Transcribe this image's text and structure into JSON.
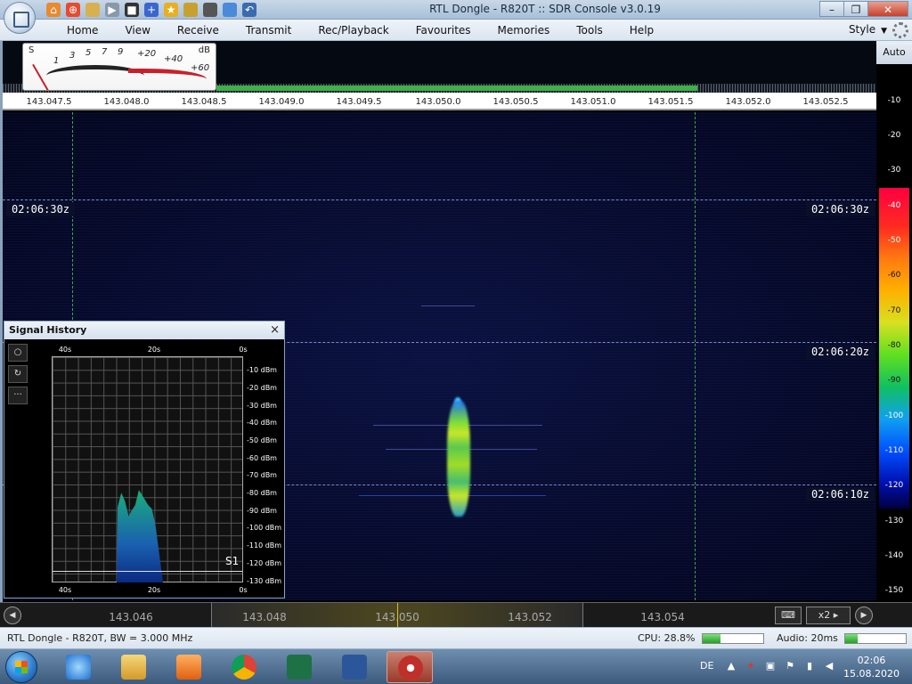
{
  "window": {
    "title": "RTL Dongle - R820T :: SDR Console v3.0.19"
  },
  "menu": [
    "Home",
    "View",
    "Receive",
    "Transmit",
    "Rec/Playback",
    "Favourites",
    "Memories",
    "Tools",
    "Help"
  ],
  "style_label": "Style",
  "smeter": {
    "s_label": "S",
    "db_label": "dB",
    "ticks": [
      "1",
      "3",
      "5",
      "7",
      "9",
      "+20",
      "+40",
      "+60"
    ]
  },
  "freq_scale": [
    "143.047.5",
    "143.048.0",
    "143.048.5",
    "143.049.0",
    "143.049.5",
    "143.050.0",
    "143.050.5",
    "143.051.0",
    "143.051.5",
    "143.052.0",
    "143.052.5"
  ],
  "waterfall": {
    "times": [
      "02:06:30z",
      "02:06:20z",
      "02:06:10z"
    ]
  },
  "db_scale": {
    "auto_label": "Auto",
    "ticks": [
      "-10",
      "-20",
      "-30",
      "-40",
      "-50",
      "-60",
      "-70",
      "-80",
      "-90",
      "-100",
      "-110",
      "-120",
      "-130",
      "-140",
      "-150"
    ]
  },
  "signal_history": {
    "title": "Signal History",
    "close": "×",
    "x_ticks": [
      "40s",
      "20s",
      "0s"
    ],
    "y_ticks": [
      "-10 dBm",
      "-20 dBm",
      "-30 dBm",
      "-40 dBm",
      "-50 dBm",
      "-60 dBm",
      "-70 dBm",
      "-80 dBm",
      "-90 dBm",
      "-100 dBm",
      "-110 dBm",
      "-120 dBm",
      "-130 dBm"
    ],
    "marker": "S1",
    "tools": [
      "○",
      "↻",
      "···"
    ]
  },
  "bottom_band": {
    "ticks": [
      "143.046",
      "143.048",
      "143.050",
      "143.052",
      "143.054"
    ],
    "zoom": "x2"
  },
  "status": {
    "left": "RTL Dongle - R820T, BW = 3.000 MHz",
    "cpu": "CPU: 28.8%",
    "cpu_level": 0.288,
    "audio": "Audio: 20ms",
    "audio_level": 0.2
  },
  "taskbar": {
    "lang": "DE",
    "time": "02:06",
    "date": "15.08.2020"
  },
  "colors": {
    "waterfall_bg": "#060a2a",
    "signal": "#9ad830",
    "accent": "#3fa04a"
  }
}
